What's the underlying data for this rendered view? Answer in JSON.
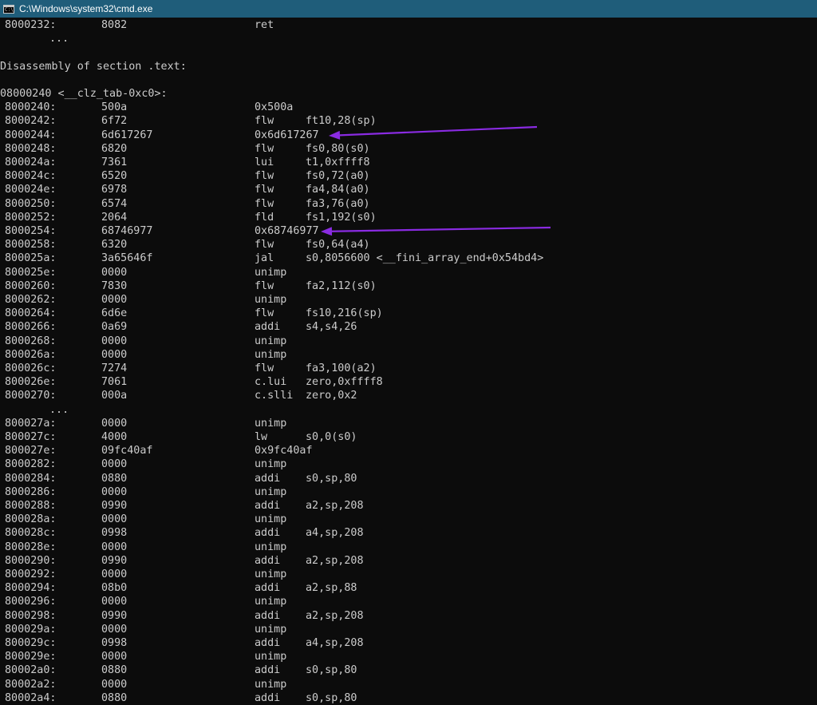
{
  "window": {
    "title": "C:\\Windows\\system32\\cmd.exe",
    "icon_label": "C:\\",
    "titlebar_color": "#1f5d7a"
  },
  "console": {
    "text_color": "#cccccc",
    "background": "#0c0c0c",
    "lines": [
      {
        "type": "instr",
        "addr": "8000232:",
        "hex": "8082",
        "mnemonic": "ret",
        "operands": ""
      },
      {
        "type": "dots",
        "text": "..."
      },
      {
        "type": "blank"
      },
      {
        "type": "text",
        "text": "Disassembly of section .text:"
      },
      {
        "type": "blank"
      },
      {
        "type": "text",
        "text": "08000240 <__clz_tab-0xc0>:"
      },
      {
        "type": "instr",
        "addr": "8000240:",
        "hex": "500a",
        "mnemonic": "0x500a",
        "operands": ""
      },
      {
        "type": "instr",
        "addr": "8000242:",
        "hex": "6f72",
        "mnemonic": "flw",
        "operands": "ft10,28(sp)"
      },
      {
        "type": "instr",
        "addr": "8000244:",
        "hex": "6d617267",
        "mnemonic": "0x6d617267",
        "operands": ""
      },
      {
        "type": "instr",
        "addr": "8000248:",
        "hex": "6820",
        "mnemonic": "flw",
        "operands": "fs0,80(s0)"
      },
      {
        "type": "instr",
        "addr": "800024a:",
        "hex": "7361",
        "mnemonic": "lui",
        "operands": "t1,0xffff8"
      },
      {
        "type": "instr",
        "addr": "800024c:",
        "hex": "6520",
        "mnemonic": "flw",
        "operands": "fs0,72(a0)"
      },
      {
        "type": "instr",
        "addr": "800024e:",
        "hex": "6978",
        "mnemonic": "flw",
        "operands": "fa4,84(a0)"
      },
      {
        "type": "instr",
        "addr": "8000250:",
        "hex": "6574",
        "mnemonic": "flw",
        "operands": "fa3,76(a0)"
      },
      {
        "type": "instr",
        "addr": "8000252:",
        "hex": "2064",
        "mnemonic": "fld",
        "operands": "fs1,192(s0)"
      },
      {
        "type": "instr",
        "addr": "8000254:",
        "hex": "68746977",
        "mnemonic": "0x68746977",
        "operands": ""
      },
      {
        "type": "instr",
        "addr": "8000258:",
        "hex": "6320",
        "mnemonic": "flw",
        "operands": "fs0,64(a4)"
      },
      {
        "type": "instr",
        "addr": "800025a:",
        "hex": "3a65646f",
        "mnemonic": "jal",
        "operands": "s0,8056600 <__fini_array_end+0x54bd4>"
      },
      {
        "type": "instr",
        "addr": "800025e:",
        "hex": "0000",
        "mnemonic": "unimp",
        "operands": ""
      },
      {
        "type": "instr",
        "addr": "8000260:",
        "hex": "7830",
        "mnemonic": "flw",
        "operands": "fa2,112(s0)"
      },
      {
        "type": "instr",
        "addr": "8000262:",
        "hex": "0000",
        "mnemonic": "unimp",
        "operands": ""
      },
      {
        "type": "instr",
        "addr": "8000264:",
        "hex": "6d6e",
        "mnemonic": "flw",
        "operands": "fs10,216(sp)"
      },
      {
        "type": "instr",
        "addr": "8000266:",
        "hex": "0a69",
        "mnemonic": "addi",
        "operands": "s4,s4,26"
      },
      {
        "type": "instr",
        "addr": "8000268:",
        "hex": "0000",
        "mnemonic": "unimp",
        "operands": ""
      },
      {
        "type": "instr",
        "addr": "800026a:",
        "hex": "0000",
        "mnemonic": "unimp",
        "operands": ""
      },
      {
        "type": "instr",
        "addr": "800026c:",
        "hex": "7274",
        "mnemonic": "flw",
        "operands": "fa3,100(a2)"
      },
      {
        "type": "instr",
        "addr": "800026e:",
        "hex": "7061",
        "mnemonic": "c.lui",
        "operands": "zero,0xffff8"
      },
      {
        "type": "instr",
        "addr": "8000270:",
        "hex": "000a",
        "mnemonic": "c.slli",
        "operands": "zero,0x2"
      },
      {
        "type": "dots",
        "text": "..."
      },
      {
        "type": "instr",
        "addr": "800027a:",
        "hex": "0000",
        "mnemonic": "unimp",
        "operands": ""
      },
      {
        "type": "instr",
        "addr": "800027c:",
        "hex": "4000",
        "mnemonic": "lw",
        "operands": "s0,0(s0)"
      },
      {
        "type": "instr",
        "addr": "800027e:",
        "hex": "09fc40af",
        "mnemonic": "0x9fc40af",
        "operands": ""
      },
      {
        "type": "instr",
        "addr": "8000282:",
        "hex": "0000",
        "mnemonic": "unimp",
        "operands": ""
      },
      {
        "type": "instr",
        "addr": "8000284:",
        "hex": "0880",
        "mnemonic": "addi",
        "operands": "s0,sp,80"
      },
      {
        "type": "instr",
        "addr": "8000286:",
        "hex": "0000",
        "mnemonic": "unimp",
        "operands": ""
      },
      {
        "type": "instr",
        "addr": "8000288:",
        "hex": "0990",
        "mnemonic": "addi",
        "operands": "a2,sp,208"
      },
      {
        "type": "instr",
        "addr": "800028a:",
        "hex": "0000",
        "mnemonic": "unimp",
        "operands": ""
      },
      {
        "type": "instr",
        "addr": "800028c:",
        "hex": "0998",
        "mnemonic": "addi",
        "operands": "a4,sp,208"
      },
      {
        "type": "instr",
        "addr": "800028e:",
        "hex": "0000",
        "mnemonic": "unimp",
        "operands": ""
      },
      {
        "type": "instr",
        "addr": "8000290:",
        "hex": "0990",
        "mnemonic": "addi",
        "operands": "a2,sp,208"
      },
      {
        "type": "instr",
        "addr": "8000292:",
        "hex": "0000",
        "mnemonic": "unimp",
        "operands": ""
      },
      {
        "type": "instr",
        "addr": "8000294:",
        "hex": "08b0",
        "mnemonic": "addi",
        "operands": "a2,sp,88"
      },
      {
        "type": "instr",
        "addr": "8000296:",
        "hex": "0000",
        "mnemonic": "unimp",
        "operands": ""
      },
      {
        "type": "instr",
        "addr": "8000298:",
        "hex": "0990",
        "mnemonic": "addi",
        "operands": "a2,sp,208"
      },
      {
        "type": "instr",
        "addr": "800029a:",
        "hex": "0000",
        "mnemonic": "unimp",
        "operands": ""
      },
      {
        "type": "instr",
        "addr": "800029c:",
        "hex": "0998",
        "mnemonic": "addi",
        "operands": "a4,sp,208"
      },
      {
        "type": "instr",
        "addr": "800029e:",
        "hex": "0000",
        "mnemonic": "unimp",
        "operands": ""
      },
      {
        "type": "instr",
        "addr": "80002a0:",
        "hex": "0880",
        "mnemonic": "addi",
        "operands": "s0,sp,80"
      },
      {
        "type": "instr",
        "addr": "80002a2:",
        "hex": "0000",
        "mnemonic": "unimp",
        "operands": ""
      },
      {
        "type": "instr",
        "addr": "80002a4:",
        "hex": "0880",
        "mnemonic": "addi",
        "operands": "s0,sp,80"
      }
    ]
  },
  "annotations": {
    "arrow_color": "#8a2be2",
    "arrows": [
      {
        "points_to_line": 8,
        "icon": "left-arrow-icon"
      },
      {
        "points_to_line": 15,
        "icon": "left-arrow-icon"
      }
    ]
  }
}
